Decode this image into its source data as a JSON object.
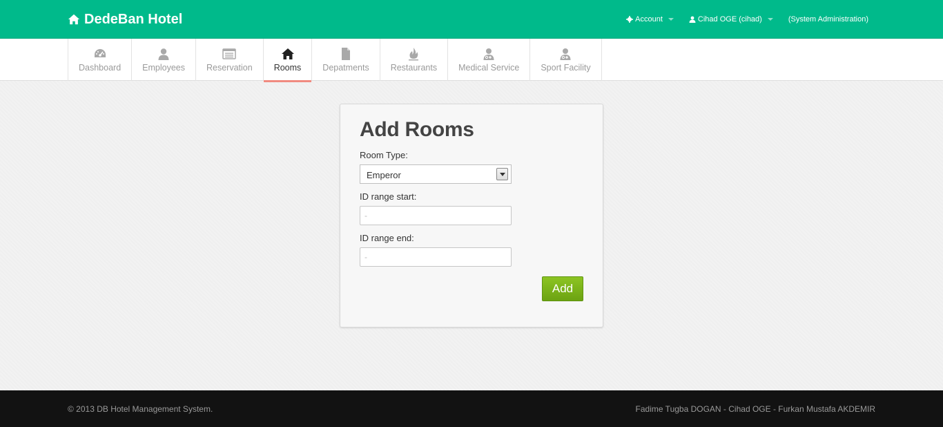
{
  "brand": {
    "title": "DedeBan Hotel",
    "icon": "home-icon"
  },
  "topnav": {
    "account_label": "Account",
    "user_label": "Cihad OGE (cihad)",
    "role_label": "(System Administration)"
  },
  "tabs": [
    {
      "label": "Dashboard",
      "icon": "dashboard-icon"
    },
    {
      "label": "Employees",
      "icon": "user-icon"
    },
    {
      "label": "Reservation",
      "icon": "list-icon"
    },
    {
      "label": "Rooms",
      "icon": "home-icon",
      "active": true
    },
    {
      "label": "Depatments",
      "icon": "file-icon"
    },
    {
      "label": "Restaurants",
      "icon": "fire-icon"
    },
    {
      "label": "Medical Service",
      "icon": "user-md-icon"
    },
    {
      "label": "Sport Facility",
      "icon": "user-md-icon"
    }
  ],
  "form": {
    "title": "Add Rooms",
    "room_type_label": "Room Type:",
    "room_type_value": "Emperor",
    "id_start_label": "ID range start:",
    "id_start_placeholder": "-",
    "id_end_label": "ID range end:",
    "id_end_placeholder": "-",
    "submit_label": "Add"
  },
  "footer": {
    "copyright": "© 2013 DB Hotel Management System.",
    "authors": "Fadime Tugba DOGAN - Cihad OGE - Furkan Mustafa AKDEMIR"
  },
  "colors": {
    "header": "#00ba8b",
    "active_tab_underline": "#f08a80",
    "add_button": "#7db31a",
    "footer": "#121212"
  }
}
